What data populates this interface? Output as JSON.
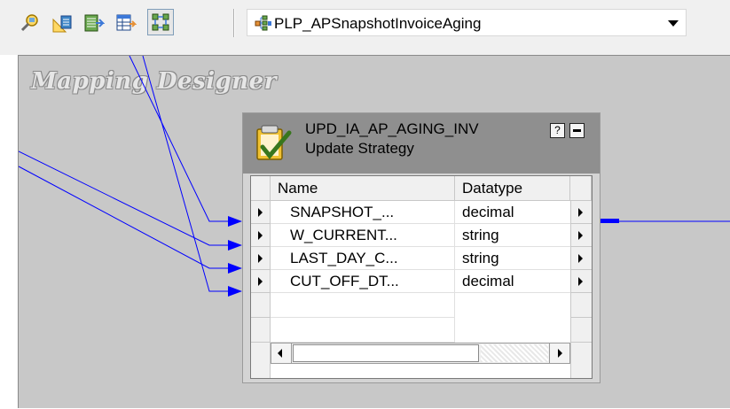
{
  "toolbar": {
    "buttons": [
      {
        "icon": "source-analyzer-icon"
      },
      {
        "icon": "target-designer-icon"
      },
      {
        "icon": "transformation-developer-icon"
      },
      {
        "icon": "mapplet-designer-icon"
      },
      {
        "icon": "mapping-designer-icon",
        "active": true
      }
    ],
    "mapping_select": {
      "value": "PLP_APSnapshotInvoiceAging",
      "icon": "mapping-icon"
    }
  },
  "canvas": {
    "title": "Mapping Designer",
    "link_color": "#0000ff"
  },
  "transformation": {
    "name": "UPD_IA_AP_AGING_INV",
    "type": "Update Strategy",
    "icon": "update-strategy-icon",
    "help_label": "?",
    "columns": [
      "Name",
      "Datatype"
    ],
    "ports": [
      {
        "name": "SNAPSHOT_...",
        "datatype": "decimal"
      },
      {
        "name": "W_CURRENT...",
        "datatype": "string"
      },
      {
        "name": "LAST_DAY_C...",
        "datatype": "string"
      },
      {
        "name": "CUT_OFF_DT...",
        "datatype": "decimal"
      }
    ]
  }
}
